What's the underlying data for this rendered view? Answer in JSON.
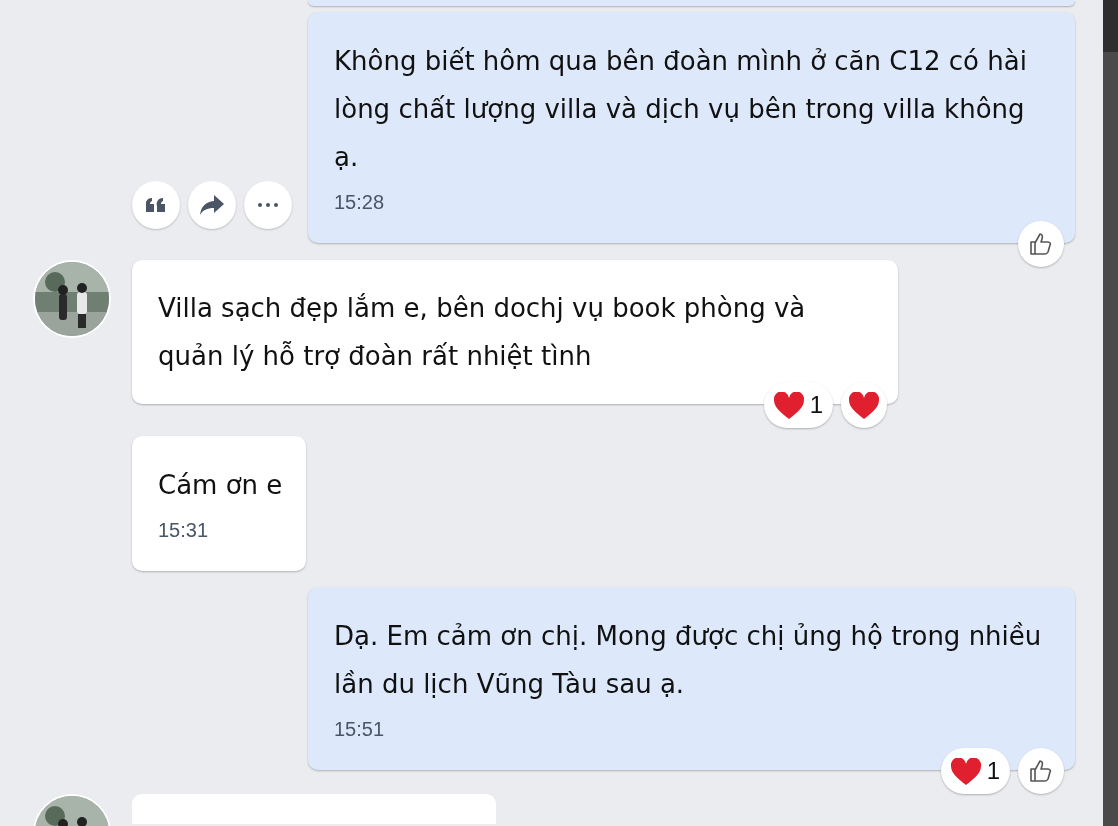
{
  "messages": [
    {
      "kind": "cut",
      "outgoing": true
    },
    {
      "kind": "text",
      "outgoing": true,
      "text": "Không biết hôm qua bên đoàn mình ở căn C12 có hài lòng chất lượng villa và dịch vụ bên trong villa không ạ.",
      "time": "15:28",
      "actions": [
        {
          "kind": "quote"
        },
        {
          "kind": "forward"
        },
        {
          "kind": "more"
        }
      ],
      "reactions": [
        {
          "kind": "like"
        }
      ]
    },
    {
      "kind": "text",
      "outgoing": false,
      "avatar": true,
      "text": "Villa sạch đẹp lắm e, bên dochj vụ book phòng và quản lý hỗ trợ đoàn rất nhiệt tình",
      "reactions": [
        {
          "kind": "heart",
          "count": "1"
        },
        {
          "kind": "heart"
        }
      ]
    },
    {
      "kind": "text",
      "outgoing": false,
      "text": "Cám ơn e",
      "time": "15:31"
    },
    {
      "kind": "text",
      "outgoing": true,
      "text": "Dạ. Em cảm ơn chị. Mong được chị ủng hộ trong nhiều lần du lịch Vũng Tàu sau ạ.",
      "time": "15:51",
      "reactions": [
        {
          "kind": "heart",
          "count": "1"
        },
        {
          "kind": "like"
        }
      ]
    },
    {
      "kind": "cut",
      "outgoing": false,
      "avatar": true
    }
  ]
}
